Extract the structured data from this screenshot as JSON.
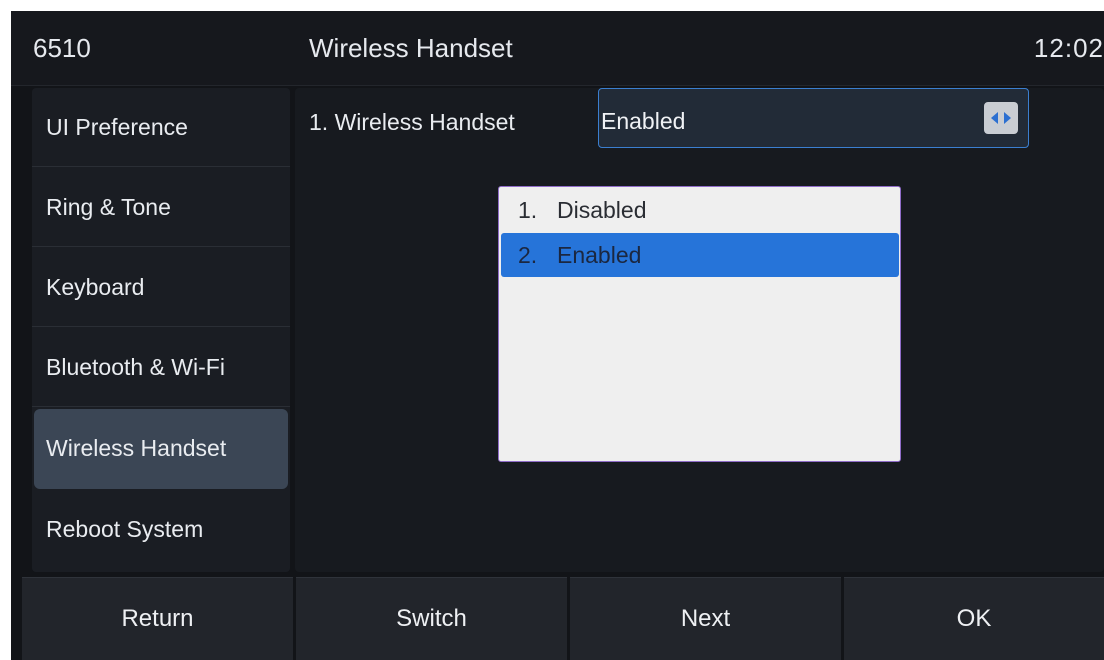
{
  "topbar": {
    "model": "6510",
    "title": "Wireless Handset",
    "clock": "12:02"
  },
  "sidebar": {
    "items": [
      {
        "label": "UI Preference"
      },
      {
        "label": "Ring & Tone"
      },
      {
        "label": "Keyboard"
      },
      {
        "label": "Bluetooth & Wi-Fi"
      },
      {
        "label": "Wireless Handset",
        "active": true
      },
      {
        "label": "Reboot System"
      }
    ]
  },
  "content": {
    "field_label": "1. Wireless Handset",
    "field_value": "Enabled",
    "toggle_icon": "left-right-arrows-icon"
  },
  "dropdown": {
    "options": [
      {
        "num": "1.",
        "label": "Disabled"
      },
      {
        "num": "2.",
        "label": "Enabled",
        "selected": true
      }
    ]
  },
  "softkeys": {
    "return": "Return",
    "switch": "Switch",
    "next": "Next",
    "ok": "OK"
  },
  "colors": {
    "accent": "#2674d9",
    "active_sidebar": "#3b4655"
  }
}
